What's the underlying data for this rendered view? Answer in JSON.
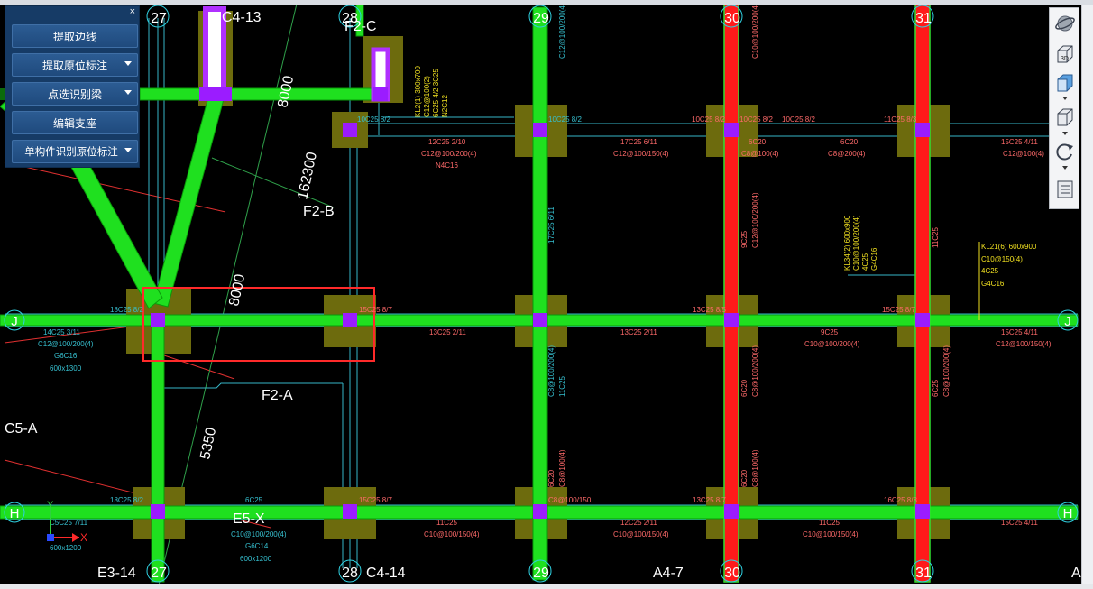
{
  "panel": {
    "close": "×",
    "buttons": [
      {
        "label": "提取边线",
        "dropdown": false
      },
      {
        "label": "提取原位标注",
        "dropdown": true
      },
      {
        "label": "点选识别梁",
        "dropdown": true
      },
      {
        "label": "编辑支座",
        "dropdown": false
      },
      {
        "label": "单构件识别原位标注",
        "dropdown": true
      }
    ]
  },
  "viewbar": {
    "label_3d": "3D"
  },
  "axes": {
    "top": [
      "27",
      "28",
      "29",
      "30",
      "31"
    ],
    "bottom": [
      "27",
      "28",
      "29",
      "30",
      "31"
    ],
    "rows": [
      "J",
      "H"
    ],
    "ucs_x": "X",
    "ucs_y": "Y"
  },
  "labels": {
    "c4_13": "C4-13",
    "f2_c": "F2-C",
    "f2_b": "F2-B",
    "f2_a": "F2-A",
    "c5_a": "C5-A",
    "e5_x": "E5-X",
    "e3_14": "E3-14",
    "c4_14": "C4-14",
    "a4_7": "A4-7",
    "a_edge": "A",
    "dim_8000_top": "8000",
    "dim_8000_mid": "8000",
    "dim_162300": "162300",
    "dim_5350": "5350"
  },
  "annotations": {
    "kl2": [
      "KL2(1) 300x700",
      "C12@100(2)",
      "6C25 4/2;3C25",
      "N2C12"
    ],
    "kl34": [
      "KL34(2) 600x900",
      "C10@100/200(4)",
      "4C25",
      "G4C16"
    ],
    "kl21": [
      "KL21(6) 600x900",
      "C10@150(4)",
      "4C25",
      "G4C16"
    ],
    "r1": [
      "10C25 8/2",
      "10C25 8/2",
      "10C25 8/2",
      "11C25 8/3"
    ],
    "r1b": [
      "12C25 2/10",
      "C12@100/200(4)",
      "N4C16",
      "17C25 6/11",
      "C12@100/150(4)",
      "6C20",
      "C8@100(4)",
      "6C20",
      "C8@200(4)",
      "15C25 4/11",
      "C12@100(4)"
    ],
    "j": [
      "15C25 8/7",
      "13C25 2/11",
      "13C25 2/11",
      "13C25 8/5",
      "9C25",
      "C10@100/200(4)",
      "15C25 8/7",
      "15C25 4/11",
      "C12@100/150(4)"
    ],
    "left": [
      "18C25 8/2",
      "14C25 3/11",
      "C12@100/200(4)",
      "G6C16",
      "600x1300",
      "16C25 8/8"
    ],
    "h": [
      "18C25 8/2",
      "6C25",
      "C10@100/200(4)",
      "G6C14",
      "600x1200",
      "15C25 8/7",
      "11C25",
      "C10@100/150(4)",
      "C8@100/150",
      "12C25 2/11",
      "C10@100/150(4)",
      "13C25 8/7",
      "11C25",
      "C10@100/150(4)",
      "16C25 8/8",
      "15C25 4/11",
      "C12@100(4)",
      "C5C25 7/11",
      "600x1200"
    ],
    "v": [
      "6C20",
      "C8@100(4)",
      "C12@100/200(4)",
      "9C25",
      "C10@100/200(4)",
      "6C20",
      "C8@100/200(4)",
      "C8@100/200(4)",
      "11C25",
      "C12@100/200(4)",
      "6C25",
      "C8@100/200(4)",
      "6C20",
      "C8@100(4)",
      "10C25 4/2",
      "15C25 8/2",
      "7C25",
      "11C25"
    ]
  }
}
